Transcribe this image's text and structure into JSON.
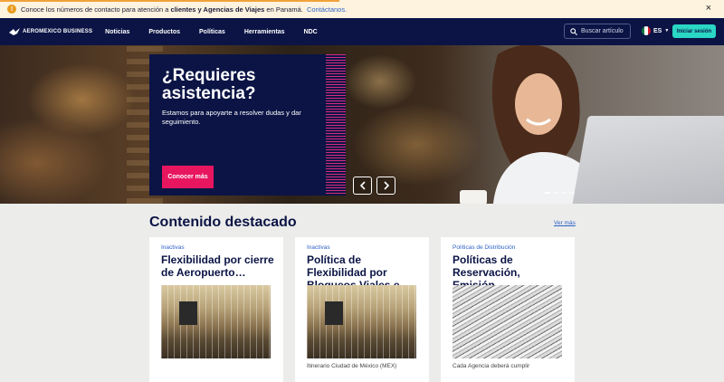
{
  "notice": {
    "text_before": "Conoce los números de contacto para atención a ",
    "text_bold": "clientes y Agencias de Viajes",
    "text_after": " en Panamá. ",
    "link": "Contáctanos.",
    "close": "×"
  },
  "nav": {
    "logo": "AEROMEXICO BUSINESS",
    "items": [
      "Noticias",
      "Productos",
      "Políticas",
      "Herramientas",
      "NDC"
    ],
    "search_placeholder": "Buscar artículo",
    "language": "ES",
    "login": "Iniciar sesión"
  },
  "hero": {
    "title": "¿Requieres asistencia?",
    "description": "Estamos para apoyarte a resolver dudas y dar seguimiento.",
    "button": "Conocer más",
    "slides": 4,
    "active_slide": 1
  },
  "featured": {
    "title": "Contenido destacado",
    "see_more": "Ver más",
    "cards": [
      {
        "category": "Inactivas",
        "title": "Flexibilidad por cierre de Aeropuerto…",
        "image": "airport-terminal",
        "desc": ""
      },
      {
        "category": "Inactivas",
        "title": "Política de Flexibilidad por Bloqueos Viales e…",
        "image": "airport-terminal",
        "desc": "Itinerario Ciudad de México (MEX)"
      },
      {
        "category": "Políticas de Distribución",
        "title": "Políticas de Reservación, Emisión…",
        "image": "stacked-papers",
        "desc": "Cada Agencia deberá cumplir"
      }
    ]
  },
  "colors": {
    "navy": "#0b1445",
    "accent_pink": "#e8165f",
    "accent_teal": "#2ad6c4",
    "link_blue": "#2f62c8"
  }
}
